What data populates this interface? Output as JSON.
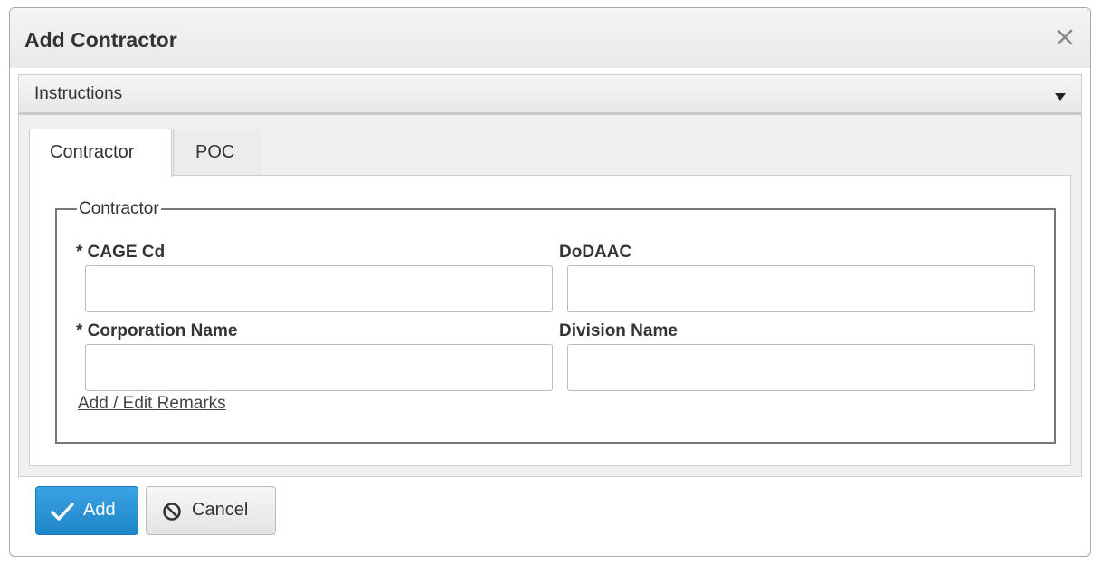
{
  "dialog": {
    "title": "Add Contractor",
    "close_icon": "close-icon"
  },
  "instructions": {
    "label": "Instructions",
    "toggle_icon": "caret-down-icon"
  },
  "tabs": [
    {
      "label": "Contractor",
      "active": true
    },
    {
      "label": "POC",
      "active": false
    }
  ],
  "contractor_group": {
    "legend": "Contractor",
    "fields": {
      "cage_cd": {
        "label": "* CAGE Cd",
        "value": ""
      },
      "dodaac": {
        "label": "DoDAAC",
        "value": ""
      },
      "corporation_name": {
        "label": "* Corporation Name",
        "value": ""
      },
      "division_name": {
        "label": "Division Name",
        "value": ""
      }
    },
    "remarks_link": "Add / Edit Remarks"
  },
  "actions": {
    "add_label": "Add",
    "add_icon": "checkmark-icon",
    "cancel_label": "Cancel",
    "cancel_icon": "prohibited-icon"
  },
  "colors": {
    "primary_button": "#2b95d6",
    "title_bar": "#eeeeee",
    "panel_background": "#f0f0f0"
  }
}
